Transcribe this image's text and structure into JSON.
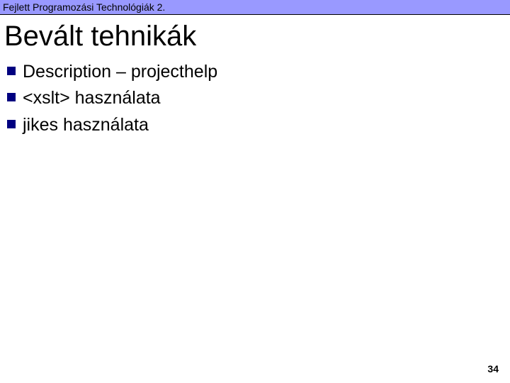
{
  "header": {
    "course_title": "Fejlett Programozási Technológiák 2."
  },
  "slide": {
    "title": "Bevált tehnikák",
    "bullets": [
      "Description – projecthelp",
      "<xslt> használata",
      "jikes használata"
    ],
    "page_number": "34"
  }
}
